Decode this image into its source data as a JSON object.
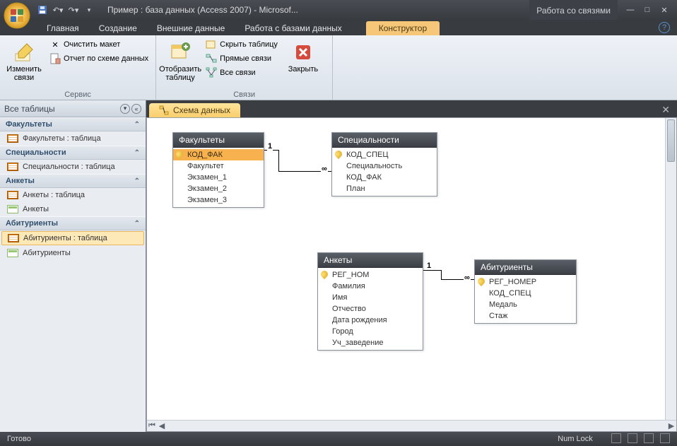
{
  "title": "Пример : база данных (Access 2007) - Microsof...",
  "context_title": "Работа со связями",
  "tabs": [
    "Главная",
    "Создание",
    "Внешние данные",
    "Работа с базами данных"
  ],
  "context_tab": "Конструктор",
  "ribbon": {
    "group_service": "Сервис",
    "group_links": "Связи",
    "edit_links": "Изменить связи",
    "clear_layout": "Очистить макет",
    "schema_report": "Отчет по схеме данных",
    "show_table": "Отобразить таблицу",
    "hide_table": "Скрыть таблицу",
    "direct_links": "Прямые связи",
    "all_links": "Все связи",
    "close": "Закрыть"
  },
  "nav": {
    "header": "Все таблицы",
    "groups": [
      {
        "title": "Факультеты",
        "items": [
          {
            "label": "Факультеты : таблица",
            "type": "table"
          }
        ]
      },
      {
        "title": "Специальности",
        "items": [
          {
            "label": "Специальности : таблица",
            "type": "table"
          }
        ]
      },
      {
        "title": "Анкеты",
        "items": [
          {
            "label": "Анкеты : таблица",
            "type": "table"
          },
          {
            "label": "Анкеты",
            "type": "form"
          }
        ]
      },
      {
        "title": "Абитуриенты",
        "items": [
          {
            "label": "Абитуриенты : таблица",
            "type": "table",
            "selected": true
          },
          {
            "label": "Абитуриенты",
            "type": "form"
          }
        ]
      }
    ]
  },
  "canvas_tab": "Схема данных",
  "tables": {
    "fak": {
      "title": "Факультеты",
      "fields": [
        "КОД_ФАК",
        "Факультет",
        "Экзамен_1",
        "Экзамен_2",
        "Экзамен_3"
      ],
      "key": 0
    },
    "spec": {
      "title": "Специальности",
      "fields": [
        "КОД_СПЕЦ",
        "Специальность",
        "КОД_ФАК",
        "План"
      ],
      "key": 0
    },
    "ank": {
      "title": "Анкеты",
      "fields": [
        "РЕГ_НОМ",
        "Фамилия",
        "Имя",
        "Отчество",
        "Дата рождения",
        "Город",
        "Уч_заведение"
      ],
      "key": 0
    },
    "abit": {
      "title": "Абитуриенты",
      "fields": [
        "РЕГ_НОМЕР",
        "КОД_СПЕЦ",
        "Медаль",
        "Стаж"
      ],
      "key": 0
    }
  },
  "rel": {
    "one": "1",
    "many": "∞"
  },
  "status": {
    "left": "Готово",
    "right": "Num Lock"
  }
}
